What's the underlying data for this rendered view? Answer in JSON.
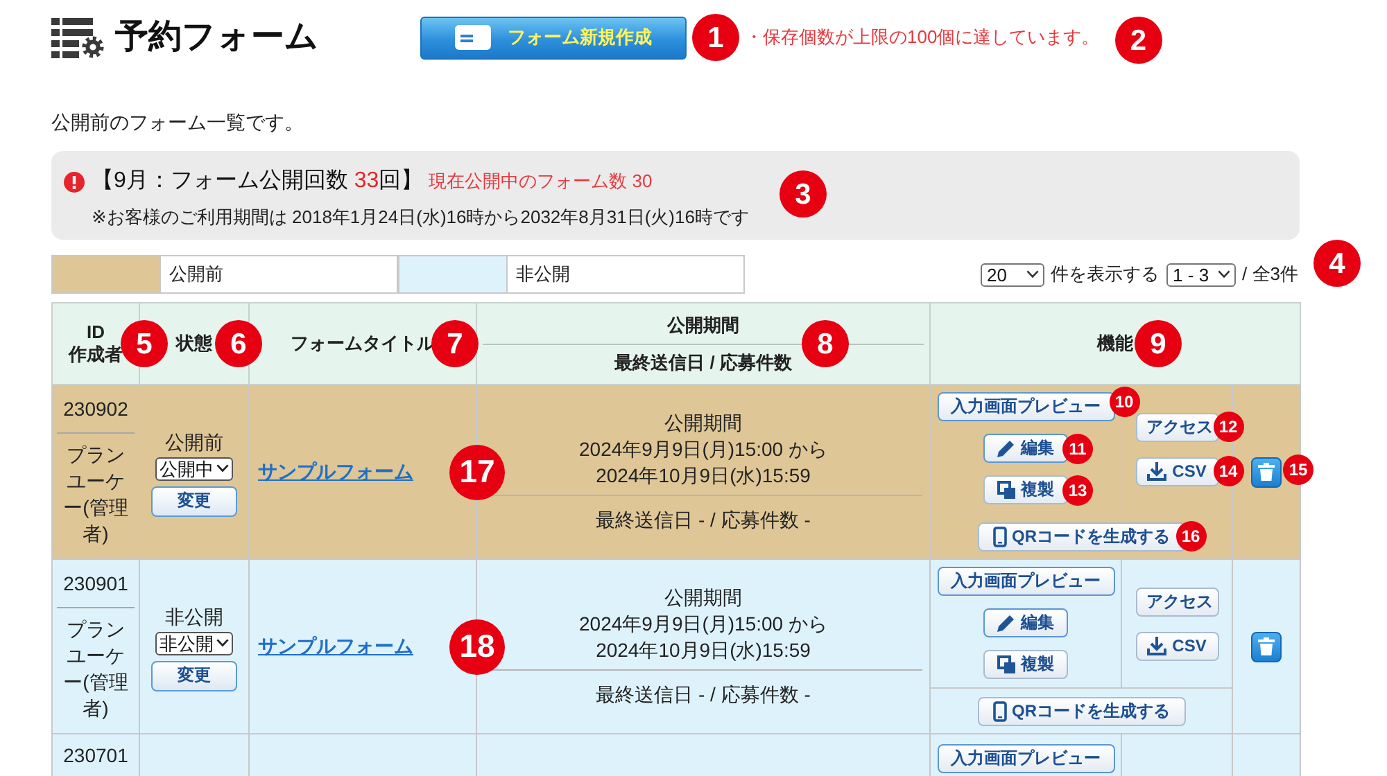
{
  "header": {
    "title": "予約フォーム",
    "new_button": {
      "label": "フォーム新規作成",
      "marker": "1"
    },
    "notice": {
      "text": "・保存個数が上限の100個に達しています。",
      "marker": "2"
    }
  },
  "intro": "公開前のフォーム一覧です。",
  "info": {
    "headline": {
      "before": "【9月：フォーム公開回数 ",
      "count": "33",
      "after": "回】"
    },
    "active": "現在公開中のフォーム数 30",
    "period": "※お客様のご利用期間は 2018年1月24日(水)16時から2032年8月31日(火)16時です",
    "marker": "3"
  },
  "legend": [
    {
      "label": "公開前",
      "color": "#dec696"
    },
    {
      "label": "非公開",
      "color": "#def2fb"
    }
  ],
  "pager": {
    "per_page": "20",
    "per_page_label": "件を表示する",
    "range": "1 - 3",
    "total": "/ 全3件",
    "marker": "4"
  },
  "table": {
    "columns": [
      {
        "kind": "stack",
        "lines": [
          "ID",
          "作成者"
        ],
        "marker": "5"
      },
      {
        "kind": "stack",
        "lines": [
          "状態"
        ],
        "marker": "6"
      },
      {
        "kind": "stack",
        "lines": [
          "フォームタイトル"
        ],
        "marker": "7"
      },
      {
        "kind": "split",
        "lines": [
          "公開期間",
          "最終送信日 / 応募件数"
        ],
        "marker": "8"
      },
      {
        "kind": "stack",
        "lines": [
          "機能"
        ],
        "marker": "9"
      }
    ],
    "rows": [
      {
        "id": "230902",
        "author": "プランユーケー(管理者)",
        "color": "#dec696",
        "status": "公開前",
        "select": "公開中",
        "change": "変更",
        "title": "サンプルフォーム",
        "period_label": "公開期間",
        "period_from": "2024年9月9日(月)15:00 から",
        "period_to": "2024年10月9日(水)15:59",
        "stats": "最終送信日 - / 応募件数 -",
        "marker": "17",
        "actions": [
          {
            "kind": "preview",
            "label": "入力画面プレビュー",
            "marker": "10"
          },
          {
            "kind": "edit",
            "label": "編集",
            "marker": "11"
          },
          {
            "kind": "copy",
            "label": "複製",
            "marker": "13"
          },
          {
            "kind": "access",
            "label": "アクセス",
            "marker": "12"
          },
          {
            "kind": "csv",
            "label": "CSV",
            "marker": "14"
          },
          {
            "kind": "delete",
            "marker": "15"
          },
          {
            "kind": "qr",
            "label": "QRコードを生成する",
            "marker": "16"
          }
        ]
      },
      {
        "id": "230901",
        "author": "プランユーケー(管理者)",
        "color": "#def2fb",
        "status": "非公開",
        "select": "非公開",
        "change": "変更",
        "title": "サンプルフォーム",
        "period_label": "公開期間",
        "period_from": "2024年9月9日(月)15:00 から",
        "period_to": "2024年10月9日(水)15:59",
        "stats": "最終送信日 - / 応募件数 -",
        "marker": "18",
        "actions": [
          {
            "kind": "preview",
            "label": "入力画面プレビュー"
          },
          {
            "kind": "edit",
            "label": "編集"
          },
          {
            "kind": "copy",
            "label": "複製"
          },
          {
            "kind": "access",
            "label": "アクセス"
          },
          {
            "kind": "csv",
            "label": "CSV"
          },
          {
            "kind": "delete"
          },
          {
            "kind": "qr",
            "label": "QRコードを生成する"
          }
        ]
      },
      {
        "id": "230701",
        "color": "#def2fb",
        "actions": [
          {
            "kind": "preview",
            "label": "入力画面プレビュー"
          }
        ]
      }
    ]
  }
}
